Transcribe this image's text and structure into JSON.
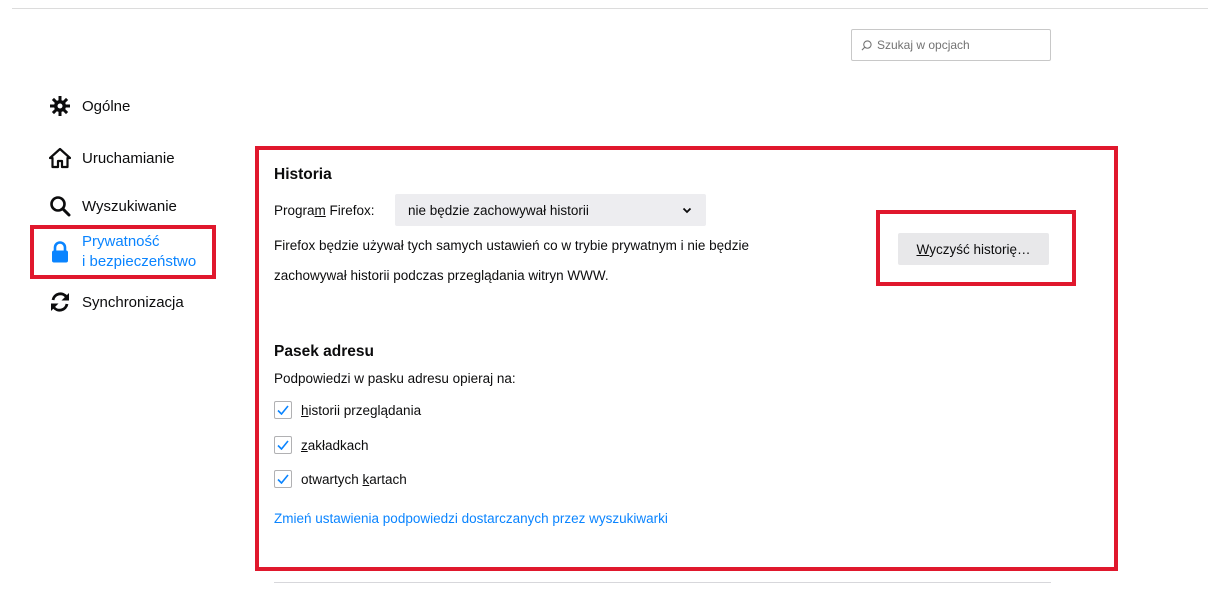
{
  "search": {
    "placeholder": "Szukaj w opcjach"
  },
  "sidebar": {
    "items": [
      {
        "label": "Ogólne",
        "icon": "gear-icon"
      },
      {
        "label": "Uruchamianie",
        "icon": "home-icon"
      },
      {
        "label": "Wyszukiwanie",
        "icon": "search-icon"
      },
      {
        "label_line1": "Prywatność",
        "label_line2": "i bezpieczeństwo",
        "icon": "lock-icon",
        "active": true
      },
      {
        "label": "Synchronizacja",
        "icon": "sync-icon"
      }
    ]
  },
  "history": {
    "title": "Historia",
    "program_label_pre": "Progra",
    "program_label_u": "m",
    "program_label_post": " Firefox:",
    "select_value": "nie będzie zachowywał historii",
    "description_line1": "Firefox będzie używał tych samych ustawień co w trybie prywatnym i nie będzie",
    "description_line2": "zachowywał historii podczas przeglądania witryn WWW.",
    "clear_button_u": "W",
    "clear_button_rest": "yczyść historię…"
  },
  "address_bar": {
    "title": "Pasek adresu",
    "subtitle": "Podpowiedzi w pasku adresu opieraj na:",
    "options": [
      {
        "u": "h",
        "rest": "istorii przeglądania",
        "checked": true
      },
      {
        "u": "z",
        "rest": "akładkach",
        "checked": true
      },
      {
        "pre": "otwartych ",
        "u": "k",
        "rest": "artach",
        "checked": true
      }
    ],
    "link": "Zmień ustawienia podpowiedzi dostarczanych przez wyszukiwarki"
  },
  "colors": {
    "accent": "#0a84ff",
    "highlight": "#e0182d"
  }
}
